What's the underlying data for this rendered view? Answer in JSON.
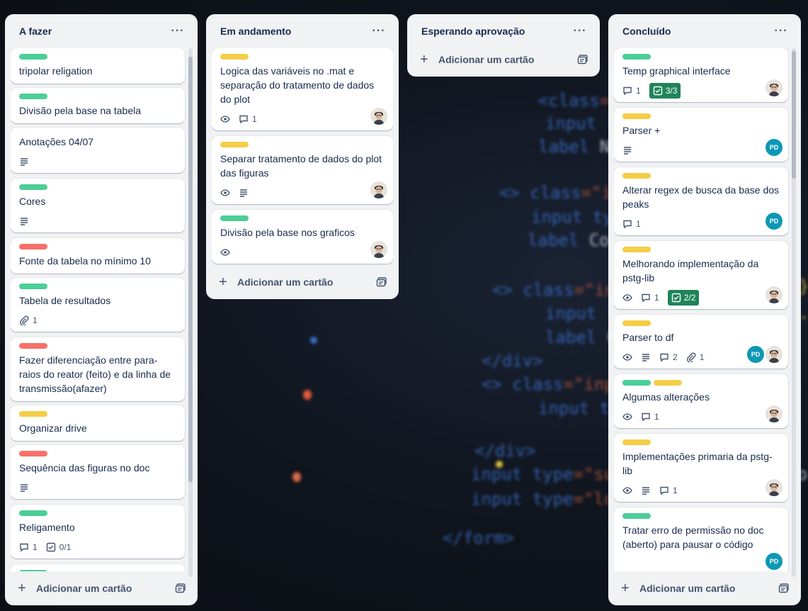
{
  "lists": [
    {
      "title": "A fazer",
      "add_label": "Adicionar um cartão",
      "cards": [
        {
          "labels": [
            "green"
          ],
          "title": "tripolar religation"
        },
        {
          "labels": [
            "green"
          ],
          "title": "Divisão pela base na tabela"
        },
        {
          "labels": [],
          "title": "Anotações 04/07",
          "badges": [
            "description"
          ]
        },
        {
          "labels": [
            "green"
          ],
          "title": "Cores",
          "badges": [
            "description"
          ]
        },
        {
          "labels": [
            "red"
          ],
          "title": "Fonte da tabela no mínimo 10"
        },
        {
          "labels": [
            "green"
          ],
          "title": "Tabela de resultados",
          "attachments": "1"
        },
        {
          "labels": [
            "red"
          ],
          "title": "Fazer diferenciação entre para-raios do reator (feito) e da linha de transmissão(afazer)"
        },
        {
          "labels": [
            "yellow"
          ],
          "title": "Organizar drive"
        },
        {
          "labels": [
            "red"
          ],
          "title": "Sequência das figuras no doc",
          "badges": [
            "description"
          ]
        },
        {
          "labels": [
            "green"
          ],
          "title": "Religamento",
          "comments": "1",
          "checklist": "0/1"
        }
      ]
    },
    {
      "title": "Em andamento",
      "add_label": "Adicionar um cartão",
      "cards": [
        {
          "labels": [
            "yellow"
          ],
          "title": "Logica das variáveis no .mat e separação do tratamento de dados do plot",
          "comments": "1"
        },
        {
          "labels": [
            "yellow"
          ],
          "title": "Separar tratamento de dados do plot das figuras"
        },
        {
          "labels": [
            "green"
          ],
          "title": "Divisão pela base nos graficos"
        }
      ]
    },
    {
      "title": "Esperando aprovação",
      "add_label": "Adicionar um cartão",
      "cards": []
    },
    {
      "title": "Concluído",
      "add_label": "Adicionar um cartão",
      "cards": [
        {
          "labels": [
            "green"
          ],
          "title": "Temp graphical interface",
          "comments": "1",
          "checklist": "3/3"
        },
        {
          "labels": [
            "yellow"
          ],
          "title": "Parser +",
          "avatar_initials": "PD"
        },
        {
          "labels": [
            "yellow"
          ],
          "title": "Alterar regex de busca da base dos peaks",
          "comments": "1",
          "avatar_initials": "PD"
        },
        {
          "labels": [
            "yellow"
          ],
          "title": "Melhorando implementação da pstg-lib",
          "comments": "1",
          "checklist": "2/2"
        },
        {
          "labels": [
            "yellow"
          ],
          "title": "Parser to df",
          "comments": "2",
          "attachments": "1",
          "avatar_initials": "PD"
        },
        {
          "labels": [
            "green",
            "yellow"
          ],
          "title": "Algumas alterações",
          "comments": "1"
        },
        {
          "labels": [
            "yellow"
          ],
          "title": "Implementações primaria da pstg-lib",
          "comments": "1"
        },
        {
          "labels": [
            "green"
          ],
          "title": "Tratar erro de permissão no doc (aberto) para pausar o código",
          "avatar_initials": "PD"
        }
      ]
    }
  ],
  "colors": {
    "label_green": "#4bce97",
    "label_yellow": "#f5cd47",
    "label_red": "#f87168",
    "checklist_done": "#1f845a",
    "avatar_pd": "#0c98b5",
    "list_bg": "#f1f2f4"
  }
}
